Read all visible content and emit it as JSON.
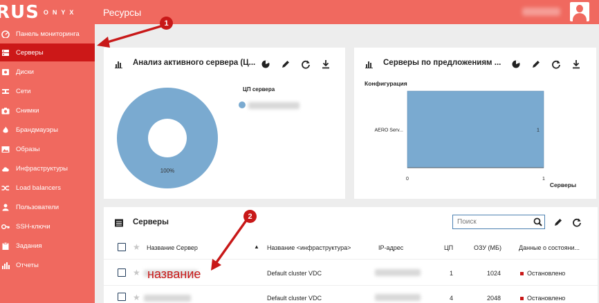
{
  "app": {
    "logo_main": "RUS",
    "logo_rest": "ONYX",
    "page_title": "Ресурсы"
  },
  "sidebar": {
    "items": [
      {
        "label": "Панель мониторинга",
        "icon": "dashboard-icon"
      },
      {
        "label": "Серверы",
        "icon": "server-icon",
        "active": true
      },
      {
        "label": "Диски",
        "icon": "disk-icon"
      },
      {
        "label": "Сети",
        "icon": "network-icon"
      },
      {
        "label": "Снимки",
        "icon": "camera-icon"
      },
      {
        "label": "Брандмауэры",
        "icon": "firewall-icon"
      },
      {
        "label": "Образы",
        "icon": "image-icon"
      },
      {
        "label": "Инфраструктуры",
        "icon": "cloud-icon"
      },
      {
        "label": "Load balancers",
        "icon": "shuffle-icon"
      },
      {
        "label": "Пользователи",
        "icon": "user-icon"
      },
      {
        "label": "SSH-ключи",
        "icon": "key-icon"
      },
      {
        "label": "Задания",
        "icon": "clipboard-icon"
      },
      {
        "label": "Отчеты",
        "icon": "bar-chart-icon"
      }
    ]
  },
  "panel1": {
    "title": "Анализ активного сервера (Ц...",
    "legend_title": "ЦП сервера",
    "chart_data": {
      "type": "pie",
      "categories": [
        ""
      ],
      "values": [
        100
      ],
      "data_labels": [
        "100%"
      ],
      "colors": [
        "#7aaad0"
      ]
    }
  },
  "panel2": {
    "title": "Серверы по предложениям ...",
    "chart_data": {
      "type": "bar",
      "orientation": "horizontal",
      "title": "Конфигурация",
      "categories": [
        "AERO Serv..."
      ],
      "values": [
        1
      ],
      "data_labels": [
        "1"
      ],
      "xlim": [
        0,
        1
      ],
      "xticks": [
        "0",
        "1"
      ],
      "xlabel": "Серверы",
      "color": "#7aaad0"
    }
  },
  "table": {
    "title": "Серверы",
    "search_placeholder": "Поиск",
    "columns": {
      "name": "Название Сервер",
      "infra": "Название <инфраструктура>",
      "ip": "IP-адрес",
      "cpu": "ЦП",
      "ram": "ОЗУ (МБ)",
      "status": "Данные о состояни..."
    },
    "rows": [
      {
        "infra": "Default cluster VDC",
        "cpu": "1",
        "ram": "1024",
        "status": "Остановлено"
      },
      {
        "infra": "Default cluster VDC",
        "cpu": "4",
        "ram": "2048",
        "status": "Остановлено"
      }
    ]
  },
  "annotations": {
    "marker1": "1",
    "marker2": "2",
    "label": "название"
  },
  "colors": {
    "brand": "#f0695f",
    "active": "#cc1818",
    "chart": "#7aaad0",
    "annotation": "#c81818"
  }
}
